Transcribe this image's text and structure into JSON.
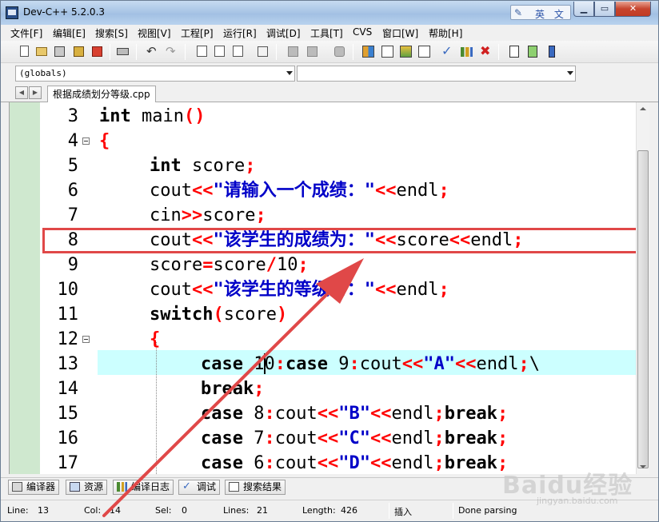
{
  "window": {
    "title": "Dev-C++ 5.2.0.3",
    "ime_label": "英 文"
  },
  "menu": [
    "文件[F]",
    "编辑[E]",
    "搜索[S]",
    "视图[V]",
    "工程[P]",
    "运行[R]",
    "调试[D]",
    "工具[T]",
    "CVS",
    "窗口[W]",
    "帮助[H]"
  ],
  "combos": {
    "scope": "(globals)",
    "member": ""
  },
  "tab": {
    "filename": "根据成绩划分等级.cpp"
  },
  "editor": {
    "lines": [
      {
        "n": "3",
        "fold": false
      },
      {
        "n": "4",
        "fold": true
      },
      {
        "n": "5",
        "fold": false
      },
      {
        "n": "6",
        "fold": false
      },
      {
        "n": "7",
        "fold": false
      },
      {
        "n": "8",
        "fold": false
      },
      {
        "n": "9",
        "fold": false
      },
      {
        "n": "10",
        "fold": false
      },
      {
        "n": "11",
        "fold": false
      },
      {
        "n": "12",
        "fold": true
      },
      {
        "n": "13",
        "fold": false
      },
      {
        "n": "14",
        "fold": false
      },
      {
        "n": "15",
        "fold": false
      },
      {
        "n": "16",
        "fold": false
      },
      {
        "n": "17",
        "fold": false
      }
    ],
    "code": {
      "l3_kw": "int",
      "l3_rest": " main",
      "l3_sym": "()",
      "l4_sym": "{",
      "l5_kw": "int",
      "l5_rest": " score",
      "l5_sym": ";",
      "l6_a": "cout",
      "l6_op": "<<",
      "l6_str": "\"请输入一个成绩：\"",
      "l6_op2": "<<",
      "l6_b": "endl",
      "l6_end": ";",
      "l7_a": "cin",
      "l7_op": ">>",
      "l7_b": "score",
      "l7_end": ";",
      "l8_a": "cout",
      "l8_op": "<<",
      "l8_str": "\"该学生的成绩为：\"",
      "l8_op2": "<<",
      "l8_b": "score",
      "l8_op3": "<<",
      "l8_c": "endl",
      "l8_end": ";",
      "l9_a": "score",
      "l9_op": "=",
      "l9_b": "score",
      "l9_op2": "/",
      "l9_num": "10",
      "l9_end": ";",
      "l10_a": "cout",
      "l10_op": "<<",
      "l10_str": "\"该学生的等级为：\"",
      "l10_op2": "<<",
      "l10_b": "endl",
      "l10_end": ";",
      "l11_kw": "switch",
      "l11_op": "(",
      "l11_b": "score",
      "l11_op2": ")",
      "l12_sym": "{",
      "l13_kw": "case",
      "l13_num": " 10",
      "l13_op": ":",
      "l13_kw2": "case",
      "l13_num2": " 9",
      "l13_op2": ":",
      "l13_a": "cout",
      "l13_op3": "<<",
      "l13_str": "\"A\"",
      "l13_op4": "<<",
      "l13_b": "endl",
      "l13_op5": ";",
      "l13_tail": "\\",
      "l14_kw": "break",
      "l14_end": ";",
      "l15_kw": "case",
      "l15_num": " 8",
      "l15_op": ":",
      "l15_a": "cout",
      "l15_op2": "<<",
      "l15_str": "\"B\"",
      "l15_op3": "<<",
      "l15_b": "endl",
      "l15_op4": ";",
      "l15_kw2": "break",
      "l15_end": ";",
      "l16_kw": "case",
      "l16_num": " 7",
      "l16_op": ":",
      "l16_a": "cout",
      "l16_op2": "<<",
      "l16_str": "\"C\"",
      "l16_op3": "<<",
      "l16_b": "endl",
      "l16_op4": ";",
      "l16_kw2": "break",
      "l16_end": ";",
      "l17_kw": "case",
      "l17_num": " 6",
      "l17_op": ":",
      "l17_a": "cout",
      "l17_op2": "<<",
      "l17_str": "\"D\"",
      "l17_op3": "<<",
      "l17_b": "endl",
      "l17_op4": ";",
      "l17_kw2": "break",
      "l17_end": ";"
    }
  },
  "bottom_tabs": [
    "编译器",
    "资源",
    "编译日志",
    "调试",
    "搜索结果"
  ],
  "status": {
    "line_label": "Line:",
    "line": "13",
    "col_label": "Col:",
    "col": "14",
    "sel_label": "Sel:",
    "sel": "0",
    "lines_label": "Lines:",
    "lines": "21",
    "length_label": "Length:",
    "length": "426",
    "mode": "插入",
    "message": "Done parsing"
  },
  "watermark": {
    "main": "Baidu经验",
    "sub": "jingyan.baidu.com"
  },
  "colors": {
    "keyword": "#000000",
    "operator": "#ff0000",
    "string": "#0000c8",
    "current_line": "#ccffff",
    "annotation": "#e04848"
  }
}
